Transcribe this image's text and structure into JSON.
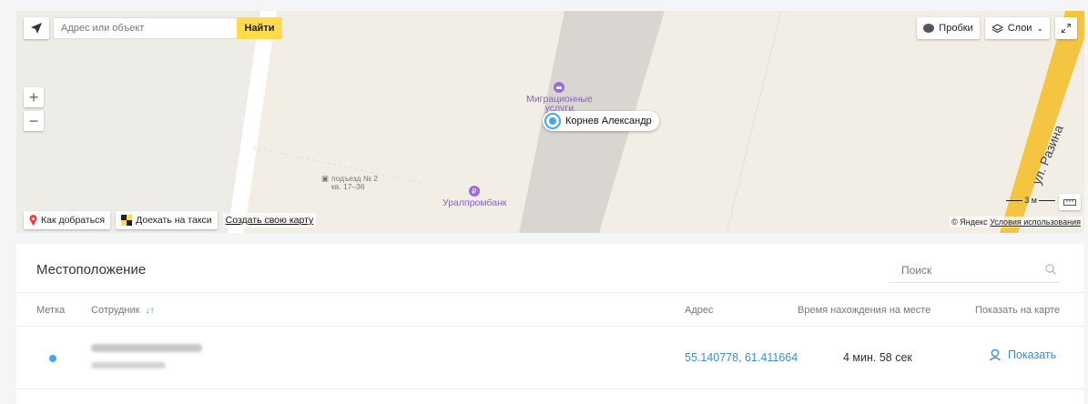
{
  "map": {
    "search_placeholder": "Адрес или объект",
    "find_label": "Найти",
    "traffic_label": "Пробки",
    "layers_label": "Слои",
    "route_label": "Как добраться",
    "taxi_label": "Доехать на такси",
    "create_map_label": "Создать свою карту",
    "poi_migration_line1": "Миграционные",
    "poi_migration_line2": "услуги",
    "poi_bank": "Уралпромбанк",
    "entrance_line1": "подъезд № 2",
    "entrance_line2": "кв. 17–36",
    "person_name": "Корнев Александр",
    "street_name": "ул. Разина",
    "scale_label": "3 м",
    "copyright_prefix": "© Яндекс",
    "terms_label": "Условия использования"
  },
  "panel": {
    "title": "Местоположение",
    "search_placeholder": "Поиск",
    "columns": {
      "mark": "Метка",
      "employee": "Сотрудник",
      "address": "Адрес",
      "time": "Время нахождения на месте",
      "show_on_map": "Показать на карте"
    },
    "rows": [
      {
        "coords": "55.140778, 61.411664",
        "duration": "4 мин. 58 сек",
        "show_label": "Показать"
      }
    ]
  },
  "colors": {
    "accent": "#3a8fd9",
    "find_button": "#ffdb4d",
    "marker": "#3da8f5"
  }
}
